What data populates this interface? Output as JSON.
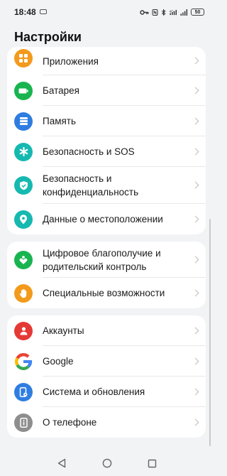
{
  "status": {
    "time": "18:48",
    "battery": "50"
  },
  "title": "Настройки",
  "groups": [
    {
      "items": [
        {
          "label": "Приложения",
          "icon": "apps-icon",
          "color": "#f39a1c"
        },
        {
          "label": "Батарея",
          "icon": "battery-icon",
          "color": "#19b450"
        },
        {
          "label": "Память",
          "icon": "storage-icon",
          "color": "#2f7de1"
        },
        {
          "label": "Безопасность и SOS",
          "icon": "sos-icon",
          "color": "#16b9b0"
        },
        {
          "label": "Безопасность и конфиденциальность",
          "icon": "shield-icon",
          "color": "#16b9b0"
        },
        {
          "label": "Данные о местоположении",
          "icon": "location-icon",
          "color": "#16b9b0"
        }
      ]
    },
    {
      "items": [
        {
          "label": "Цифровое благополучие и родительский контроль",
          "icon": "wellbeing-icon",
          "color": "#19b450"
        },
        {
          "label": "Специальные возможности",
          "icon": "hand-icon",
          "color": "#f39a1c"
        }
      ]
    },
    {
      "items": [
        {
          "label": "Аккаунты",
          "icon": "account-icon",
          "color": "#e53935"
        },
        {
          "label": "Google",
          "icon": "google-icon",
          "color": "#ffffff"
        },
        {
          "label": "Система и обновления",
          "icon": "system-icon",
          "color": "#2f7de1"
        },
        {
          "label": "О телефоне",
          "icon": "info-icon",
          "color": "#8e8e8e"
        }
      ]
    }
  ]
}
